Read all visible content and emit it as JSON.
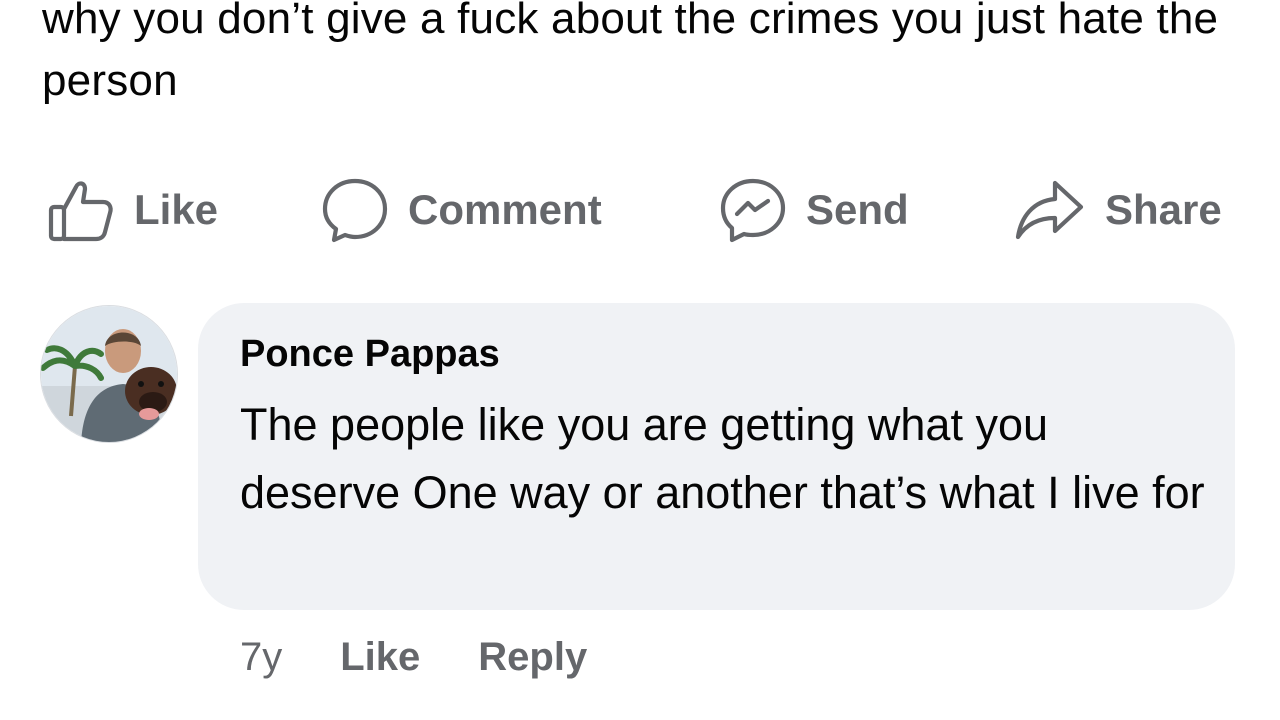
{
  "post": {
    "text": "why you don’t give a fuck about the crimes you just hate the person"
  },
  "actions": {
    "like": {
      "label": "Like",
      "icon": "thumbs-up-icon"
    },
    "comment": {
      "label": "Comment",
      "icon": "comment-bubble-icon"
    },
    "send": {
      "label": "Send",
      "icon": "messenger-icon"
    },
    "share": {
      "label": "Share",
      "icon": "share-arrow-icon"
    }
  },
  "comment": {
    "author": "Ponce Pappas",
    "text": "The people like you are getting what you deserve One way or another that’s what I live for",
    "time": "7y",
    "like_label": "Like",
    "reply_label": "Reply"
  },
  "colors": {
    "text_primary": "#050505",
    "text_secondary": "#65676b",
    "bubble_bg": "#f0f2f5"
  }
}
